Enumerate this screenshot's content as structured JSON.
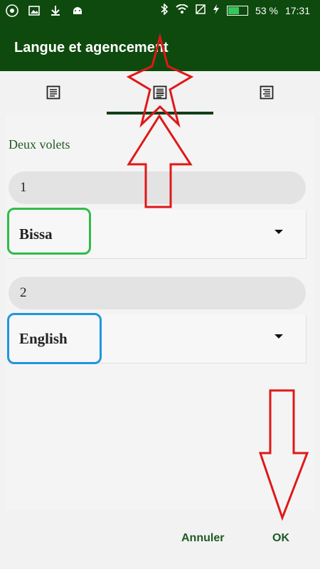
{
  "status_bar": {
    "battery_percent": "53 %",
    "time": "17:31",
    "battery_level": 0.53,
    "icons": [
      "app-icon",
      "image-icon",
      "download-icon",
      "android-icon",
      "bluetooth-icon",
      "wifi-icon",
      "no-sim-icon",
      "charging-icon",
      "battery-icon"
    ]
  },
  "app_bar": {
    "title": "Langue et agencement"
  },
  "tabs": [
    {
      "icon": "single-pane-icon"
    },
    {
      "icon": "two-pane-icon",
      "selected": true
    },
    {
      "icon": "interlinear-icon"
    }
  ],
  "layout": {
    "title": "Deux volets",
    "panes": [
      {
        "number": "1",
        "language": "Bissa"
      },
      {
        "number": "2",
        "language": "English"
      }
    ]
  },
  "dialog": {
    "cancel_label": "Annuler",
    "ok_label": "OK"
  },
  "annotations": {
    "colors": {
      "red": "#e01818",
      "green": "#2ebd46",
      "blue": "#1f96de"
    },
    "marks": [
      "star",
      "arrow-up",
      "highlight-box-green",
      "highlight-box-blue",
      "arrow-down"
    ]
  },
  "colors": {
    "primary": "#0e4a0e",
    "accent": "#1f5a26",
    "background": "#f2f2f2"
  }
}
